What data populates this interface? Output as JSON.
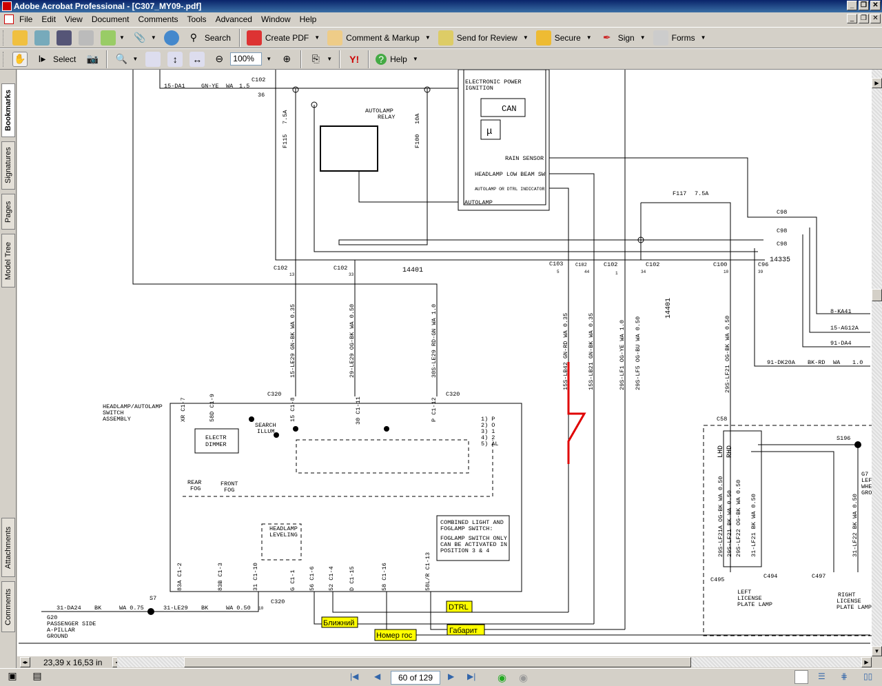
{
  "window": {
    "title": "Adobe Acrobat Professional - [C307_MY09-.pdf]"
  },
  "menu": [
    "File",
    "Edit",
    "View",
    "Document",
    "Comments",
    "Tools",
    "Advanced",
    "Window",
    "Help"
  ],
  "toolbar1": {
    "search": "Search",
    "create_pdf": "Create PDF",
    "comment_markup": "Comment & Markup",
    "send_review": "Send for Review",
    "secure": "Secure",
    "sign": "Sign",
    "forms": "Forms"
  },
  "toolbar2": {
    "select": "Select",
    "zoom": "100%",
    "help": "Help",
    "yahoo": "Y!"
  },
  "left_tabs": [
    "Bookmarks",
    "Signatures",
    "Pages",
    "Model Tree",
    "Attachments",
    "Comments"
  ],
  "status": {
    "page_size": "23,39 x 16,53 in",
    "page": "60 of 129"
  },
  "colors": {
    "annotation_line": "#e00000",
    "highlight": "#ffff00"
  },
  "diagram": {
    "labels": [
      "15-DA1",
      "GN-YE",
      "WA",
      "1.5",
      "C102",
      "36",
      "F115",
      "7.5A",
      "AUTOLAMP",
      "RELAY",
      "F100",
      "10A",
      "ELECTRONIC POWER",
      "IGNITION",
      "CAN",
      "μ",
      "RAIN SENSOR",
      "HEADLAMP LOW BEAM SW",
      "AUTOLAMP OR DTRL INDICATOR",
      "AUTOLAMP",
      "F117",
      "7.5A",
      "C98",
      "C98",
      "C98",
      "14335",
      "C102",
      "13",
      "C102",
      "33",
      "14401",
      "C103",
      "5",
      "C102",
      "44",
      "C102",
      "1",
      "C102",
      "34",
      "C100",
      "10",
      "C96",
      "39",
      "14401",
      "8-KA41",
      "15-AG12A",
      "91-DA4",
      "91-DK20A",
      "BK-RD",
      "WA",
      "1.0",
      "C320",
      "C320",
      "C58",
      "S196",
      "HEADLAMP/AUTOLAMP",
      "SWITCH",
      "ASSEMBLY",
      "ELECTR",
      "DIMMER",
      "SEARCH",
      "ILLUM",
      "REAR",
      "FOG",
      "FRONT",
      "FOG",
      "HEADLAMP",
      "LEVELING",
      "1) P",
      "2) O",
      "3) 1",
      "4) 2",
      "5) AL",
      "COMBINED LIGHT AND",
      "FOGLAMP SWITCH:",
      "FOGLAMP SWITCH ONLY",
      "CAN BE ACTIVATED IN",
      "POSITION 3 & 4",
      "S7",
      "31-DA24",
      "BK",
      "WA 0.75",
      "31-LE29",
      "BK",
      "WA 0.50",
      "10",
      "C320",
      "G20",
      "PASSENGER SIDE",
      "A-PILLAR",
      "GROUND",
      "C495",
      "C494",
      "C497",
      "LEFT",
      "LICENSE",
      "PLATE LAMP",
      "RIGHT",
      "LICENSE",
      "PLATE LAMP",
      "G7",
      "LEFT",
      "WHEEL",
      "GROUND"
    ],
    "vlabels": [
      "15-LE29  GN-BK  WA 0.35",
      "29-LE29  OG-BK  WA 0.50",
      "30S-LE29  RD-GN  WA 1.0",
      "15S-LB42  GN-RD  WA 0.35",
      "15S-LB21  GN-BK  WA 0.35",
      "29S-LF1  OG-YE  WA 1.0",
      "29S-LF5  OG-BU  WA 0.50",
      "29S-LF21  OG-BK  WA 0.50",
      "29S-LF21A  OG-BK  WA 0.50",
      "29S-LF21  BK  WA 0.50",
      "29S-LF22  OG-BK  WA 0.50",
      "31-LF21  BK  WA 0.50",
      "31-LF22  BK  WA 0.50",
      "LHD",
      "RHD",
      "XR C1-7",
      "58D C1-9",
      "15 C1-8",
      "30 C1-11",
      "P C1-12",
      "83A C1-2",
      "83B C1-3",
      "31 C1-10",
      "G C1-1",
      "56 C1-6",
      "52 C1-4",
      "D C1-15",
      "58 C1-16",
      "58L/R C1-13"
    ],
    "annotations": {
      "dtrl": "DTRL",
      "low_beam": "Ближний",
      "plate": "Номер гос",
      "side": "Габарит"
    }
  }
}
